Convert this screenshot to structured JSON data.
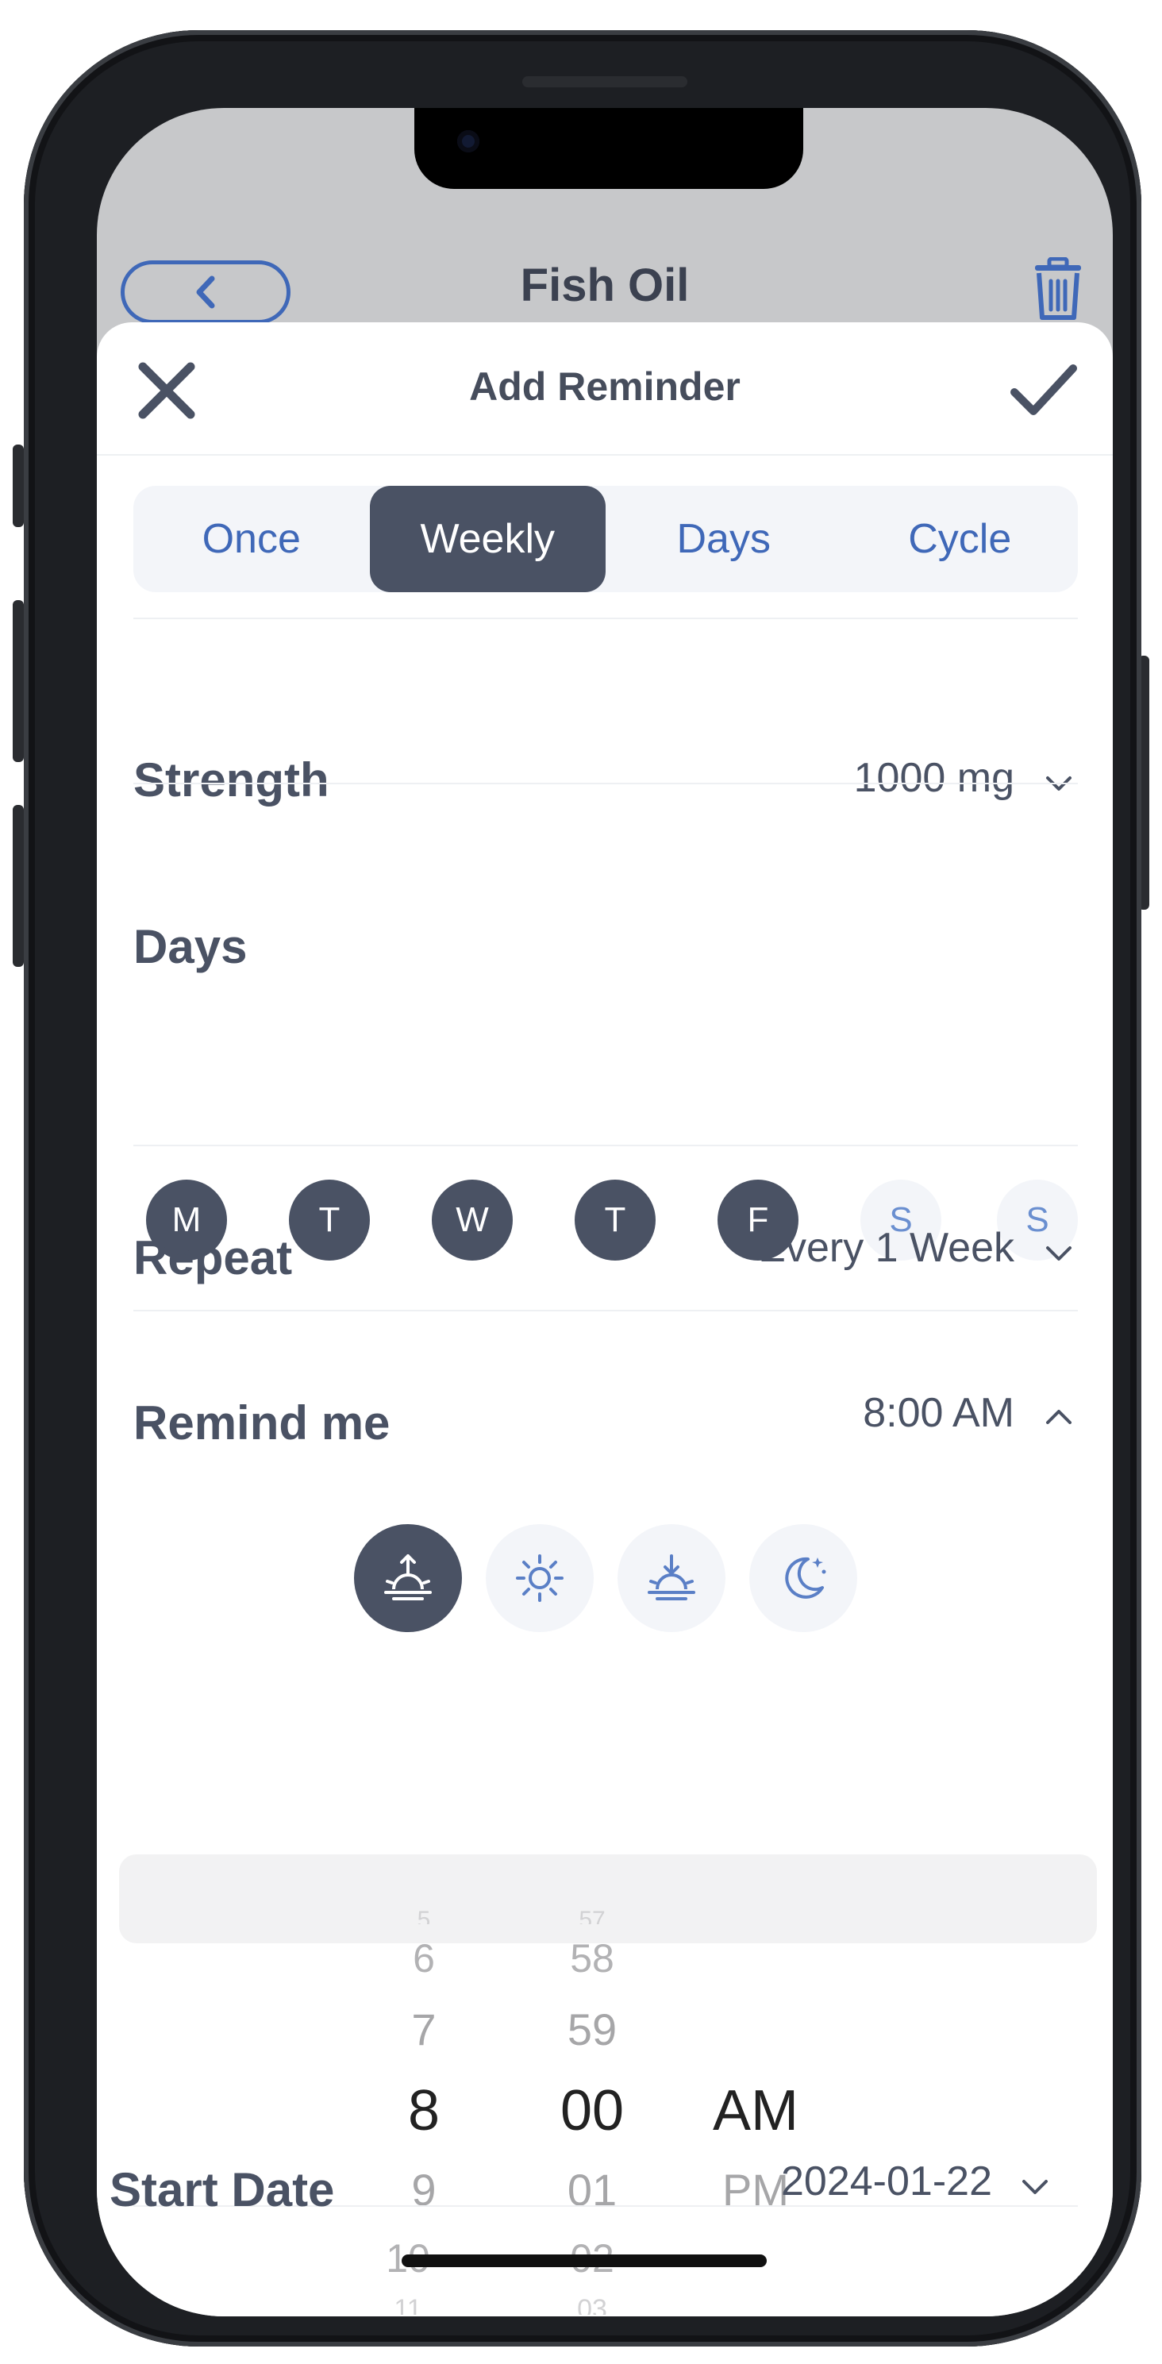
{
  "background_screen": {
    "title": "Fish Oil"
  },
  "sheet": {
    "title": "Add Reminder",
    "tabs": [
      "Once",
      "Weekly",
      "Days",
      "Cycle"
    ],
    "active_tab": "Weekly",
    "strength": {
      "label": "Strength",
      "value": "1000 mg"
    },
    "days": {
      "label": "Days",
      "items": [
        {
          "letter": "M",
          "selected": true
        },
        {
          "letter": "T",
          "selected": true
        },
        {
          "letter": "W",
          "selected": true
        },
        {
          "letter": "T",
          "selected": true
        },
        {
          "letter": "F",
          "selected": true
        },
        {
          "letter": "S",
          "selected": false
        },
        {
          "letter": "S",
          "selected": false
        }
      ]
    },
    "repeat": {
      "label": "Repeat",
      "value": "Every 1 Week"
    },
    "remind": {
      "label": "Remind me",
      "value": "8:00 AM",
      "time_of_day_icons": [
        "sunrise-icon",
        "sun-icon",
        "sunset-icon",
        "moon-icon"
      ],
      "selected_time_of_day": "sunrise-icon"
    },
    "picker": {
      "hours": [
        "5",
        "6",
        "7",
        "8",
        "9",
        "10",
        "11"
      ],
      "minutes": [
        "57",
        "58",
        "59",
        "00",
        "01",
        "02",
        "03"
      ],
      "periods": [
        "AM",
        "PM"
      ]
    },
    "start_date": {
      "label": "Start Date",
      "value": "2024-01-22"
    }
  },
  "colors": {
    "accent_blue": "#3f68b8",
    "dark_slate": "#4a5264",
    "light_chip": "#f3f5f9"
  }
}
